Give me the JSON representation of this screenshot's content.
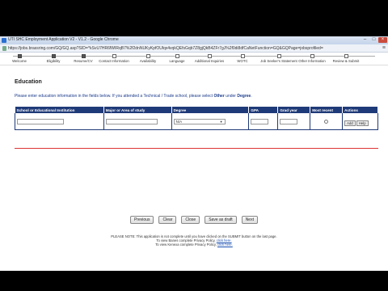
{
  "window": {
    "title": "UTI SHC Employment Application V2 - V1.2 - Google Chrome",
    "url": "https://jobs.brassring.com/GQ/GQ.asp?SID=^kSvU7HR6fWIRqB7%2f2dnNUKyKpfOUlqx4vqkQEfsGqb7Z8gjQkB4ZFr7gJ%2f0di8dfCaNetFunction=GQ&GQPage=jobsprofiled=",
    "menu_icon": "≡"
  },
  "steps": [
    {
      "label": "Welcome",
      "done": true
    },
    {
      "label": "Eligibility",
      "done": true
    },
    {
      "label": "Resume/CV",
      "done": true
    },
    {
      "label": "Contact Information",
      "done": false
    },
    {
      "label": "Availability",
      "done": false
    },
    {
      "label": "Language",
      "done": false
    },
    {
      "label": "Additional Inquiries",
      "done": false
    },
    {
      "label": "WOTC",
      "done": false
    },
    {
      "label": "Job Seeker's Statement",
      "done": false
    },
    {
      "label": "Other Information",
      "done": false
    },
    {
      "label": "Review & Submit",
      "done": false
    }
  ],
  "section": {
    "heading": "Education",
    "instructions_pre": "Please enter education information in the fields below. If you attended a Technical / Trade school, please select ",
    "instructions_bold1": "Other",
    "instructions_mid": " under ",
    "instructions_bold2": "Degree",
    "instructions_post": "."
  },
  "table": {
    "headers": {
      "school": "School or Educational Institution",
      "major": "Major or Area of study",
      "degree": "Degree",
      "gpa": "GPA",
      "grad_year": "Grad year",
      "most_recent": "Most recent",
      "actions": "Actions"
    },
    "row": {
      "degree_value": "N/A",
      "add_label": "Add",
      "help_label": "Help"
    }
  },
  "buttons": {
    "previous": "Previous",
    "clear": "Clear",
    "close": "Close",
    "save_draft": "Save as draft",
    "next": "Next"
  },
  "notes": {
    "n1": "PLEASE NOTE: This application is not complete until you have clicked on the SUBMIT button on the last page.",
    "n2_pre": "To view Banes complete Privacy Policy, ",
    "n2_link": "click here.",
    "n3_pre": "To view Kenexa complete Privacy Policy, ",
    "n3_link": "click here."
  },
  "colors": {
    "header_bg": "#1f3a78",
    "accent_line": "#d33333",
    "instructions_text": "#1a3a8a"
  }
}
